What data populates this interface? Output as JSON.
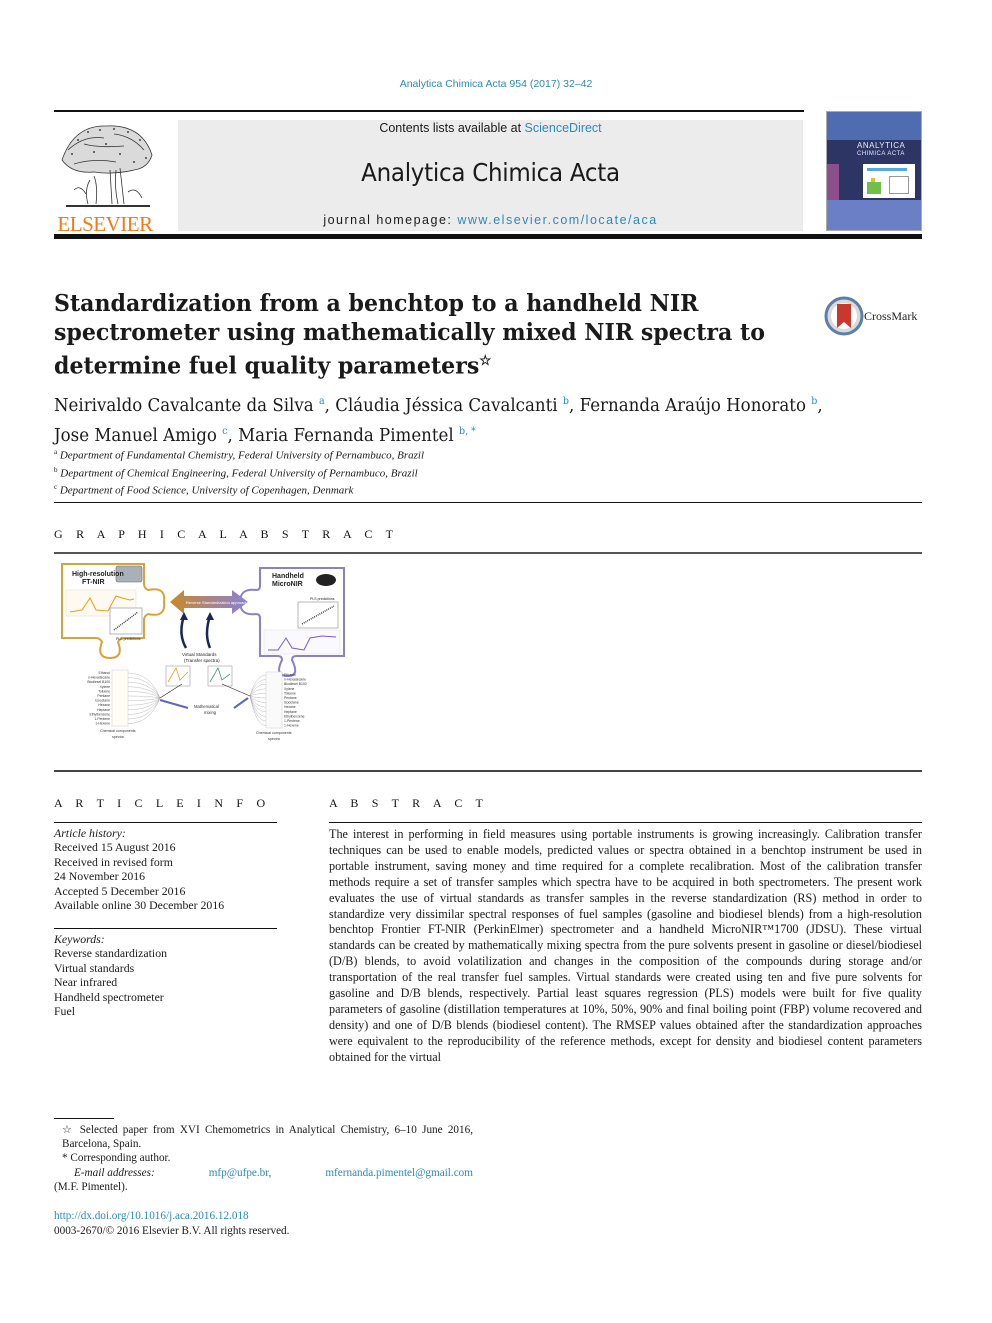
{
  "journal": {
    "citation": "Analytica Chimica Acta 954 (2017) 32–42",
    "contents_prefix": "Contents lists available at ",
    "contents_link": "ScienceDirect",
    "name": "Analytica Chimica Acta",
    "homepage_prefix": "journal homepage: ",
    "homepage_url": "www.elsevier.com/locate/aca",
    "publisher_logo": "ELSEVIER",
    "cover_title_line1": "ANALYTICA",
    "cover_title_line2": "CHIMICA ACTA"
  },
  "colors": {
    "link": "#2a8ab8",
    "elsevier_orange": "#f07a1a",
    "header_box": "#ececec",
    "cover_navy": "#2c3563"
  },
  "article": {
    "title": "Standardization from a benchtop to a handheld NIR spectrometer using mathematically mixed NIR spectra to determine fuel quality parameters",
    "title_mark": "☆",
    "crossmark_label": "CrossMark",
    "authors": [
      {
        "name": "Neirivaldo Cavalcante da Silva",
        "aff": "a",
        "sep": ", "
      },
      {
        "name": "Cláudia Jéssica Cavalcanti",
        "aff": "b",
        "sep": ", "
      },
      {
        "name": "Fernanda Araújo Honorato",
        "aff": "b",
        "sep": ","
      },
      {
        "name": "Jose Manuel Amigo",
        "aff": "c",
        "sep": ", "
      },
      {
        "name": "Maria Fernanda Pimentel",
        "aff": "b, *",
        "sep": ""
      }
    ],
    "affiliations": [
      {
        "key": "a",
        "text": "Department of Fundamental Chemistry, Federal University of Pernambuco, Brazil"
      },
      {
        "key": "b",
        "text": "Department of Chemical Engineering, Federal University of Pernambuco, Brazil"
      },
      {
        "key": "c",
        "text": "Department of Food Science, University of Copenhagen, Denmark"
      }
    ]
  },
  "graphical_abstract": {
    "heading": "G R A P H I C A L  A B S T R A C T",
    "left_label_line1": "High-resolution",
    "left_label_line2": "FT-NIR",
    "right_label_line1": "Handheld",
    "right_label_line2": "MicroNIR",
    "arrow_label": "Reverse Standardization approach",
    "pls_label": "PLS predictions",
    "virtual_label_line1": "Virtual Standards",
    "virtual_label_line2": "(Transfer spectra)",
    "mixing_label_line1": "Mathematical",
    "mixing_label_line2": "mixing",
    "components_label_line1": "Chemical components",
    "components_label_line2": "spectra",
    "left_components": [
      "Ethanol",
      "n-Hexadecane",
      "Biodiesel B100",
      "Xylene",
      "Toluene",
      "Pentane",
      "Isooctane",
      "Hexane",
      "Heptane",
      "Ethylbenzene",
      "1-Pentene",
      "1-Hexene"
    ],
    "right_components": [
      "Ethanol",
      "n-Hexadecane",
      "Biodiesel B100",
      "Xylene",
      "Toluene",
      "Pentane",
      "Isooctane",
      "Hexane",
      "Heptane",
      "Ethylbenzene",
      "1-Pentene",
      "1-Hexene"
    ]
  },
  "article_info": {
    "heading": "A R T I C L E  I N F O",
    "history_label": "Article history:",
    "history": [
      "Received 15 August 2016",
      "Received in revised form",
      "24 November 2016",
      "Accepted 5 December 2016",
      "Available online 30 December 2016"
    ],
    "keywords_label": "Keywords:",
    "keywords": [
      "Reverse standardization",
      "Virtual standards",
      "Near infrared",
      "Handheld spectrometer",
      "Fuel"
    ]
  },
  "abstract": {
    "heading": "A B S T R A C T",
    "text": "The interest in performing in field measures using portable instruments is growing increasingly. Cali­bration transfer techniques can be used to enable models, predicted values or spectra obtained in a benchtop instrument be used in portable instrument, saving money and time required for a complete recalibration. Most of the calibration transfer methods require a set of transfer samples which spectra have to be acquired in both spectrometers. The present work evaluates the use of virtual standards as transfer samples in the reverse standardization (RS) method in order to standardize very dissimilar spectral responses of fuel samples (gasoline and biodiesel blends) from a high-resolution benchtop Frontier FT-NIR (PerkinElmer) spectrometer and a handheld MicroNIR™1700 (JDSU). These virtual standards can be created by mathematically mixing spectra from the pure solvents present in gasoline or diesel/biodiesel (D/B) blends, to avoid volatilization and changes in the composition of the compounds during storage and/or transportation of the real transfer fuel samples. Virtual standards were created using ten and five pure solvents for gasoline and D/B blends, respectively. Partial least squares regression (PLS) models were built for five quality parameters of gasoline (distillation temperatures at 10%, 50%, 90% and final boiling point (FBP) volume recovered and density) and one of D/B blends (biodiesel content). The RMSEP values obtained after the standardization approaches were equivalent to the reproducibility of the reference methods, except for density and biodiesel content parameters obtained for the virtual"
  },
  "footnotes": {
    "star_note": "☆ Selected paper from XVI Chemometrics in Analytical Chemistry, 6–10 June 2016, Barcelona, Spain.",
    "corresponding": "* Corresponding author.",
    "email_label": "E-mail addresses:",
    "email1": "mfp@ufpe.br,",
    "email2": "mfernanda.pimentel@gmail.com",
    "email_owner": "(M.F. Pimentel).",
    "doi": "http://dx.doi.org/10.1016/j.aca.2016.12.018",
    "copyright": "0003-2670/© 2016 Elsevier B.V. All rights reserved."
  }
}
